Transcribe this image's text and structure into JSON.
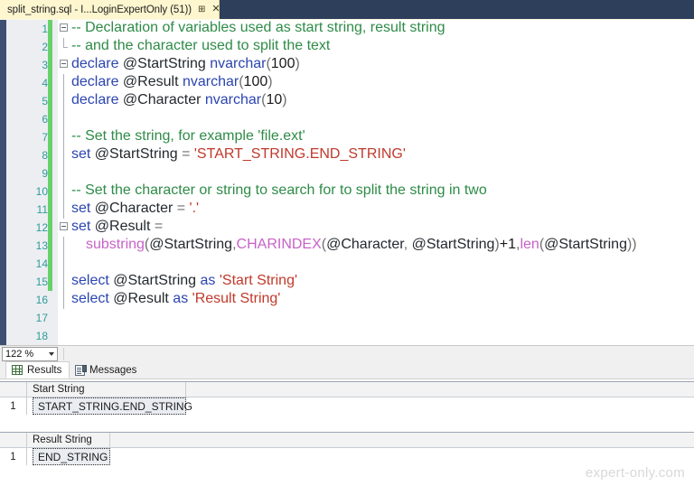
{
  "window": {
    "tab_title": "split_string.sql - I...LoginExpertOnly (51))",
    "pin_icon": "⊞",
    "close_icon": "✕"
  },
  "editor": {
    "lines": [
      {
        "num": "1",
        "changed": true,
        "outline": "collapse",
        "tokens": [
          {
            "t": "comment",
            "v": "-- Declaration of variables used as start string, result string"
          }
        ]
      },
      {
        "num": "2",
        "changed": true,
        "outline": "elbow",
        "tokens": [
          {
            "t": "comment",
            "v": "-- and the character used to split the text"
          }
        ]
      },
      {
        "num": "3",
        "changed": true,
        "outline": "collapse",
        "tokens": [
          {
            "t": "kw",
            "v": "declare "
          },
          {
            "t": "var",
            "v": "@StartString "
          },
          {
            "t": "kw",
            "v": "nvarchar"
          },
          {
            "t": "punct",
            "v": "("
          },
          {
            "t": "num",
            "v": "100"
          },
          {
            "t": "punct",
            "v": ")"
          }
        ]
      },
      {
        "num": "4",
        "changed": true,
        "outline": "line",
        "tokens": [
          {
            "t": "kw",
            "v": "declare "
          },
          {
            "t": "var",
            "v": "@Result "
          },
          {
            "t": "kw",
            "v": "nvarchar"
          },
          {
            "t": "punct",
            "v": "("
          },
          {
            "t": "num",
            "v": "100"
          },
          {
            "t": "punct",
            "v": ")"
          }
        ]
      },
      {
        "num": "5",
        "changed": true,
        "outline": "line",
        "tokens": [
          {
            "t": "kw",
            "v": "declare "
          },
          {
            "t": "var",
            "v": "@Character "
          },
          {
            "t": "kw",
            "v": "nvarchar"
          },
          {
            "t": "punct",
            "v": "("
          },
          {
            "t": "num",
            "v": "10"
          },
          {
            "t": "punct",
            "v": ")"
          }
        ]
      },
      {
        "num": "6",
        "changed": true,
        "outline": "line",
        "tokens": []
      },
      {
        "num": "7",
        "changed": true,
        "outline": "line",
        "tokens": [
          {
            "t": "comment",
            "v": "-- Set the string, for example 'file.ext'"
          }
        ]
      },
      {
        "num": "8",
        "changed": true,
        "outline": "line",
        "tokens": [
          {
            "t": "kw",
            "v": "set "
          },
          {
            "t": "var",
            "v": "@StartString "
          },
          {
            "t": "op",
            "v": "= "
          },
          {
            "t": "str",
            "v": "'START_STRING.END_STRING'"
          }
        ]
      },
      {
        "num": "9",
        "changed": true,
        "outline": "line",
        "tokens": []
      },
      {
        "num": "10",
        "changed": true,
        "outline": "line",
        "tokens": [
          {
            "t": "comment",
            "v": "-- Set the character or string to search for to split the string in two"
          }
        ]
      },
      {
        "num": "11",
        "changed": true,
        "outline": "line",
        "tokens": [
          {
            "t": "kw",
            "v": "set "
          },
          {
            "t": "var",
            "v": "@Character "
          },
          {
            "t": "op",
            "v": "= "
          },
          {
            "t": "str",
            "v": "'.'"
          }
        ]
      },
      {
        "num": "12",
        "changed": true,
        "outline": "collapse",
        "tokens": [
          {
            "t": "kw",
            "v": "set "
          },
          {
            "t": "var",
            "v": "@Result "
          },
          {
            "t": "op",
            "v": "="
          }
        ]
      },
      {
        "num": "13",
        "changed": true,
        "outline": "line",
        "indent": 2,
        "tokens": [
          {
            "t": "fn",
            "v": "substring"
          },
          {
            "t": "punct",
            "v": "("
          },
          {
            "t": "var",
            "v": "@StartString"
          },
          {
            "t": "punct",
            "v": ","
          },
          {
            "t": "fn",
            "v": "CHARINDEX"
          },
          {
            "t": "punct",
            "v": "("
          },
          {
            "t": "var",
            "v": "@Character"
          },
          {
            "t": "punct",
            "v": ", "
          },
          {
            "t": "var",
            "v": "@StartString"
          },
          {
            "t": "punct",
            "v": ")"
          },
          {
            "t": "plain",
            "v": "+1"
          },
          {
            "t": "punct",
            "v": ","
          },
          {
            "t": "fn",
            "v": "len"
          },
          {
            "t": "punct",
            "v": "("
          },
          {
            "t": "var",
            "v": "@StartString"
          },
          {
            "t": "punct",
            "v": "))"
          }
        ]
      },
      {
        "num": "14",
        "changed": true,
        "outline": "line",
        "tokens": []
      },
      {
        "num": "15",
        "changed": true,
        "outline": "line",
        "tokens": [
          {
            "t": "kw",
            "v": "select "
          },
          {
            "t": "var",
            "v": "@StartString "
          },
          {
            "t": "kw",
            "v": "as "
          },
          {
            "t": "str",
            "v": "'Start String'"
          }
        ]
      },
      {
        "num": "16",
        "changed": false,
        "outline": "line",
        "tokens": [
          {
            "t": "kw",
            "v": "select "
          },
          {
            "t": "var",
            "v": "@Result "
          },
          {
            "t": "kw",
            "v": "as "
          },
          {
            "t": "str",
            "v": "'Result String'"
          }
        ]
      },
      {
        "num": "17",
        "changed": false,
        "outline": "line",
        "tokens": []
      },
      {
        "num": "18",
        "changed": false,
        "outline": "line",
        "tokens": []
      }
    ]
  },
  "zoombar": {
    "zoom_level": "122 %"
  },
  "results": {
    "tabs": [
      {
        "label": "Results",
        "icon": "grid-icon",
        "active": true
      },
      {
        "label": "Messages",
        "icon": "document-icon",
        "active": false
      }
    ],
    "grids": [
      {
        "column": "Start String",
        "row_number": "1",
        "value": "START_STRING.END_STRING"
      },
      {
        "column": "Result String",
        "row_number": "1",
        "value": "END_STRING"
      }
    ]
  },
  "watermark": "expert-only.com",
  "colors": {
    "chrome": "#2e3f5c",
    "tab_active": "#fdf6cf",
    "change_bar": "#68d16a",
    "comment": "#2e8b47",
    "keyword": "#2b45b0",
    "string": "#c0392b",
    "function": "#c862c8",
    "line_number": "#2f9b9b"
  }
}
